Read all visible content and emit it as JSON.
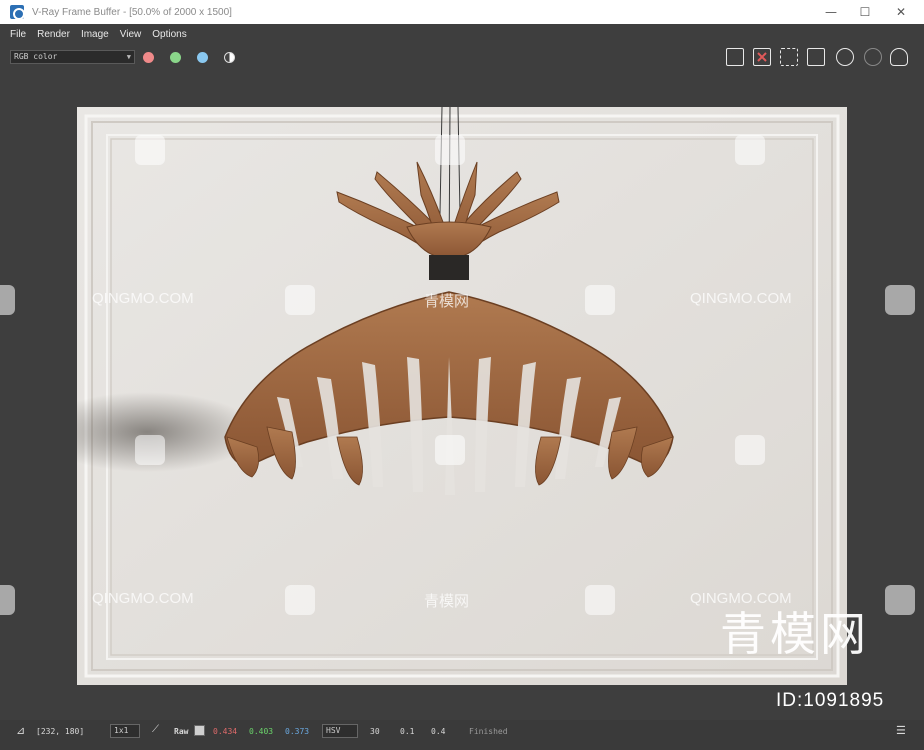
{
  "window": {
    "title": "V-Ray Frame Buffer - [50.0% of 2000 x 1500]",
    "minimize": "—",
    "maximize": "☐",
    "close": "✕"
  },
  "menu": [
    "File",
    "Render",
    "Image",
    "View",
    "Options"
  ],
  "toolbar": {
    "channel": "RGB color",
    "channel_dots": [
      "#f08a8a",
      "#8ad68a",
      "#8ac8f0"
    ],
    "icons": [
      "save-icon",
      "clear-icon",
      "region-icon",
      "track-icon",
      "render-icon",
      "render-region-icon",
      "teapot-icon"
    ]
  },
  "status": {
    "coords": "[232, 180]",
    "zoom": "1x1",
    "mode": "Raw",
    "r": "0.434",
    "g": "0.403",
    "b": "0.373",
    "colorspace": "HSV",
    "h": "30",
    "s": "0.1",
    "v": "0.4",
    "state": "Finished"
  },
  "colors": {
    "r": "#e06b6b",
    "g": "#6bd46b",
    "b": "#6ba9e0"
  },
  "watermarks": {
    "site": "QINGMO.COM",
    "cn": "青模网",
    "brand_big": "青模网",
    "brand_id": "ID:1091895"
  }
}
